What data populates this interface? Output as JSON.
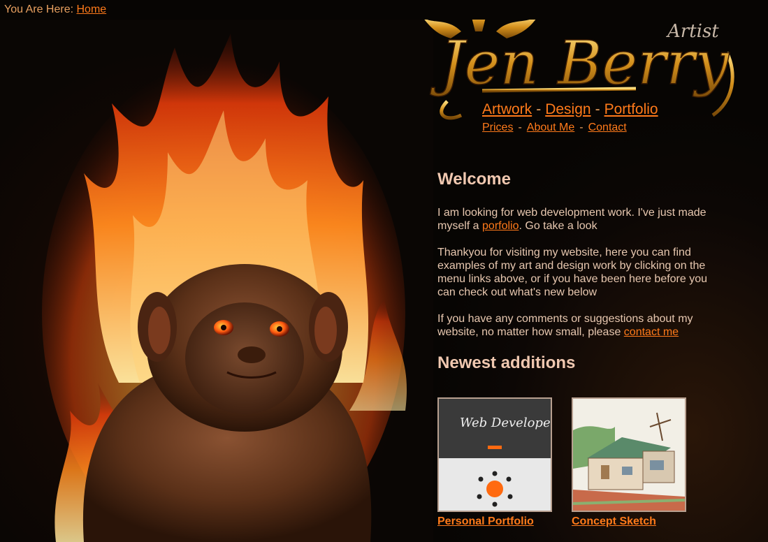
{
  "breadcrumb": {
    "label": "You Are Here:",
    "link": "Home"
  },
  "logo": {
    "name": "Jen Berry",
    "tagline": "Artist"
  },
  "nav": {
    "primary": [
      "Artwork",
      "Design",
      "Portfolio"
    ],
    "secondary": [
      "Prices",
      "About Me",
      "Contact"
    ]
  },
  "welcome": {
    "title": "Welcome",
    "p1_before": "I am looking for web development work. I've just made myself a ",
    "p1_link": "porfolio",
    "p1_after": ". Go take a look",
    "p2": "Thankyou for visiting my website, here you can find examples of my art and design work by clicking on the menu links above, or if you have been here before you can check out what's new below",
    "p3_before": "If you have any comments or suggestions about my website, no matter how small, please ",
    "p3_link": "contact me"
  },
  "newest": {
    "title": "Newest additions",
    "items": [
      {
        "caption": "Personal Portfolio",
        "thumb_text": "Web Developer"
      },
      {
        "caption": "Concept Sketch"
      }
    ]
  },
  "colors": {
    "link": "#ff7a1a",
    "heading": "#f0c8b0",
    "background": "#0a0604",
    "logo_gold": "#d4901c"
  }
}
